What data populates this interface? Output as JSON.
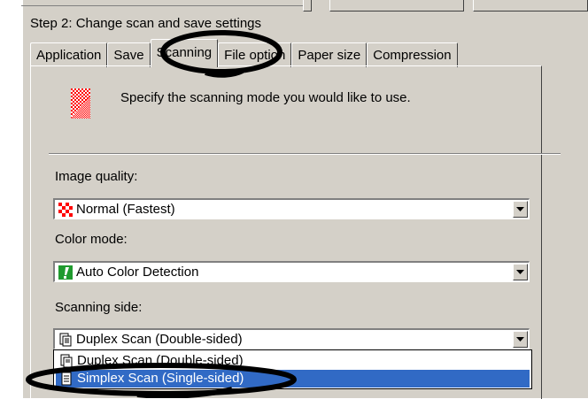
{
  "step_title": "Step 2: Change scan and save settings",
  "tabs": [
    {
      "label": "Application",
      "active": false
    },
    {
      "label": "Save",
      "active": false
    },
    {
      "label": "Scanning",
      "active": true
    },
    {
      "label": "File option",
      "active": false
    },
    {
      "label": "Paper size",
      "active": false
    },
    {
      "label": "Compression",
      "active": false
    }
  ],
  "panel": {
    "intro_icon": "scan-checker-icon",
    "intro_text": "Specify the scanning mode you would like to use."
  },
  "image_quality": {
    "label": "Image quality:",
    "value": "Normal (Fastest)",
    "icon": "quality-checker-icon"
  },
  "color_mode": {
    "label": "Color mode:",
    "value": "Auto Color Detection",
    "icon": "auto-color-icon"
  },
  "scanning_side": {
    "label": "Scanning side:",
    "value": "Duplex Scan (Double-sided)",
    "icon": "duplex-icon",
    "options": [
      {
        "label": "Duplex Scan (Double-sided)",
        "icon": "duplex-icon",
        "selected": false
      },
      {
        "label": "Simplex Scan (Single-sided)",
        "icon": "simplex-icon",
        "selected": true
      }
    ]
  },
  "colors": {
    "dialog_bg": "#d4d0c8",
    "selection": "#316ac5",
    "checker_red": "#ff0000"
  }
}
